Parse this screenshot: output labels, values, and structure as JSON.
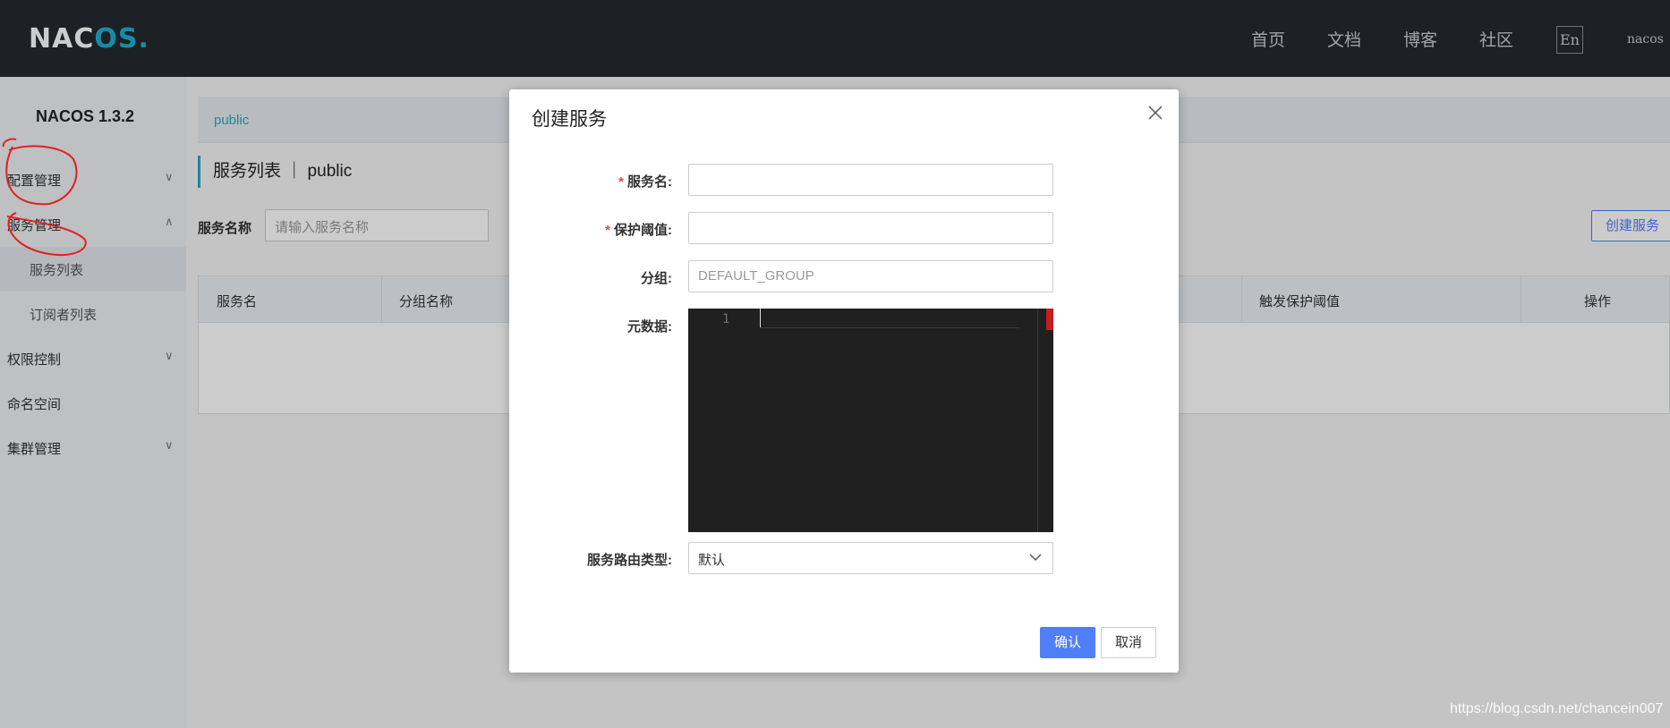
{
  "header": {
    "logo_text": "NAC",
    "logo_accent": "OS",
    "logo_end": ".",
    "nav": [
      "首页",
      "文档",
      "博客",
      "社区"
    ],
    "lang_button": "En",
    "user": "nacos"
  },
  "sidebar": {
    "version": "NACOS 1.3.2",
    "items": [
      {
        "label": "配置管理"
      },
      {
        "label": "服务管理"
      },
      {
        "label": "服务列表"
      },
      {
        "label": "订阅者列表"
      },
      {
        "label": "权限控制"
      },
      {
        "label": "命名空间"
      },
      {
        "label": "集群管理"
      }
    ]
  },
  "main": {
    "namespace_tab": "public",
    "page_title": "服务列表 ｜ public",
    "search_label": "服务名称",
    "search_placeholder": "请输入服务名称",
    "create_button": "创建服务",
    "table_headers": [
      "服务名",
      "分组名称",
      "触发保护阈值",
      "操作"
    ]
  },
  "dialog": {
    "title": "创建服务",
    "required_mark": "*",
    "fields": {
      "service_name_label": "服务名:",
      "protect_threshold_label": "保护阈值:",
      "group_label": "分组:",
      "group_placeholder": "DEFAULT_GROUP",
      "metadata_label": "元数据:",
      "editor_line_number": "1",
      "selector_label": "服务路由类型:",
      "selector_value": "默认"
    },
    "confirm_button": "确认",
    "cancel_button": "取消"
  },
  "watermark": "https://blog.csdn.net/chancein007",
  "colors": {
    "topbar_bg": "#252a2f",
    "accent_cyan": "#2aa7c5",
    "primary_blue": "#4f7ef7",
    "required_red": "#e5483e",
    "editor_bg": "#202020",
    "annotation_red": "#e02020"
  }
}
